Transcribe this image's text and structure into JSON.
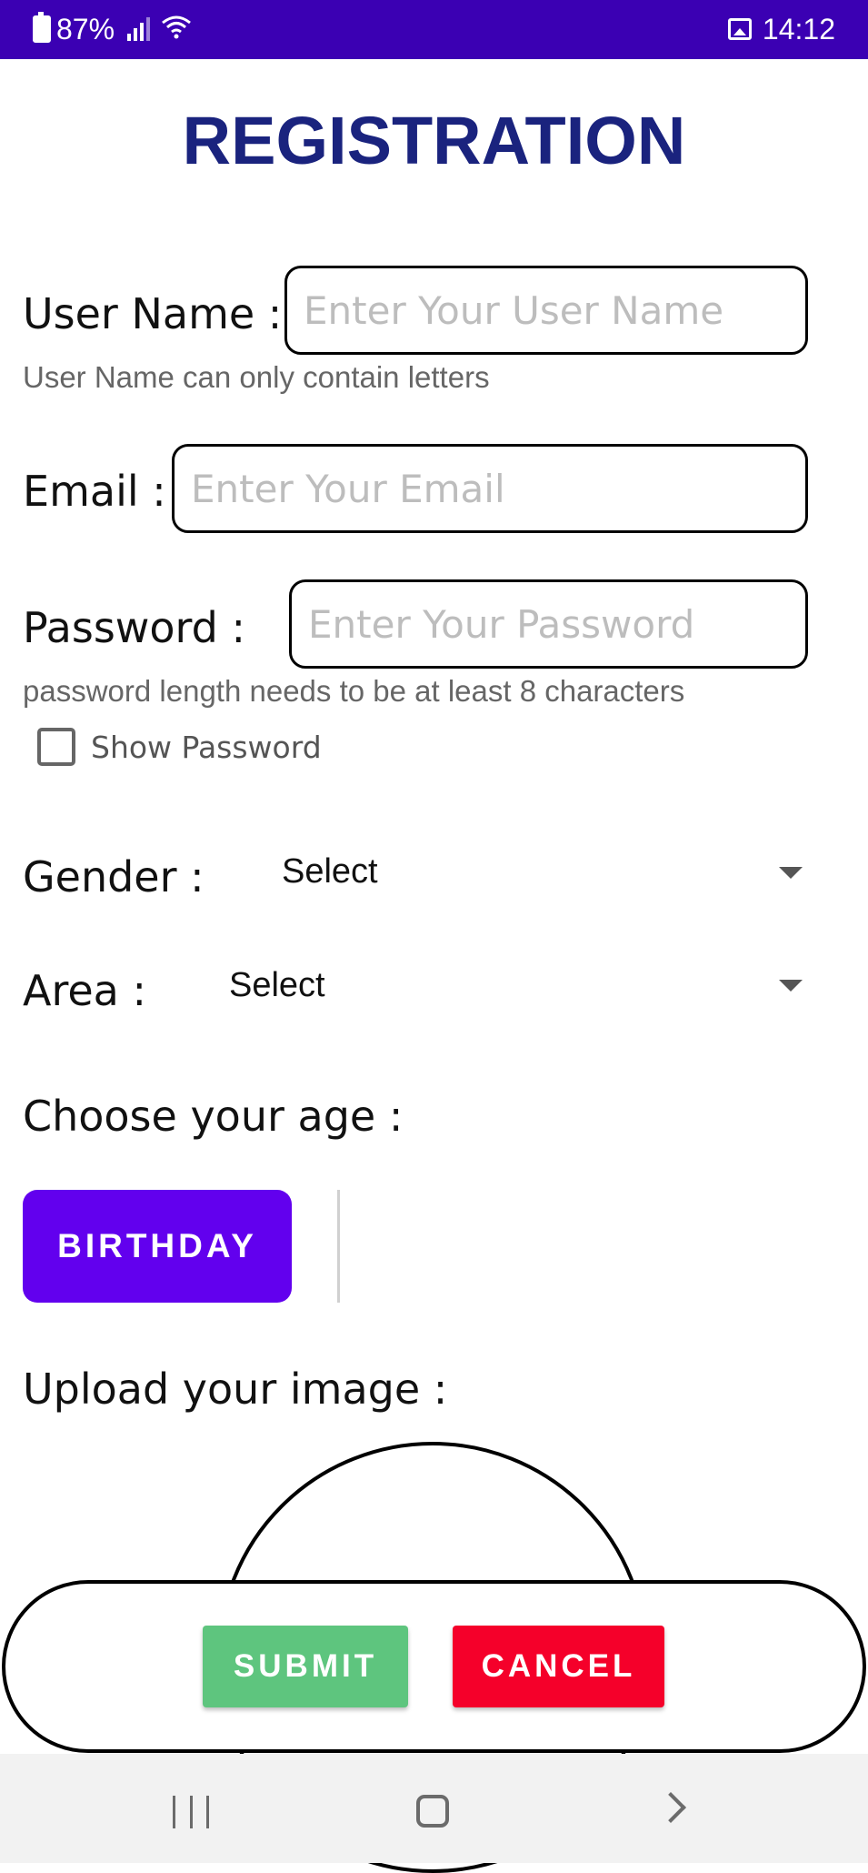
{
  "status_bar": {
    "battery": "87%",
    "time": "14:12",
    "icons": [
      "battery-icon",
      "signal-icon",
      "wifi-icon",
      "gallery-icon"
    ]
  },
  "title": "REGISTRATION",
  "form": {
    "username": {
      "label": "User Name :",
      "placeholder": "Enter Your User Name",
      "value": "",
      "hint": "User Name can only contain letters"
    },
    "email": {
      "label": "Email :",
      "placeholder": "Enter Your Email",
      "value": ""
    },
    "password": {
      "label": "Password :",
      "placeholder": "Enter Your Password",
      "value": "",
      "hint": "password length needs to be at least 8 characters",
      "show_password_label": "Show Password"
    },
    "gender": {
      "label": "Gender :",
      "selected": "Select"
    },
    "area": {
      "label": "Area :",
      "selected": "Select"
    },
    "age": {
      "label": "Choose your age :",
      "button": "BIRTHDAY"
    },
    "image": {
      "label": "Upload your image :"
    }
  },
  "actions": {
    "submit": "SUBMIT",
    "cancel": "CANCEL"
  },
  "colors": {
    "status_bar": "#3b00b3",
    "title": "#1a237e",
    "birthday_button": "#6200ee",
    "submit_button": "#5ec57e",
    "cancel_button": "#f5002a"
  },
  "nav_bar": {
    "icons": [
      "recents-icon",
      "home-icon",
      "back-icon"
    ]
  }
}
